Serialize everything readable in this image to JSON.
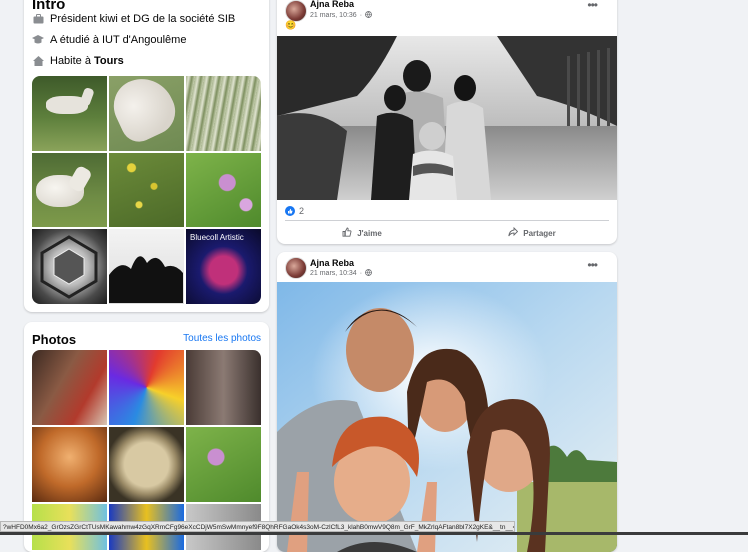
{
  "intro": {
    "title": "Intro",
    "work": "Président kiwi et DG de la société SIB",
    "education": "A étudié à IUT d'Angoulême",
    "lives_prefix": "Habite à ",
    "lives_city": "Tours",
    "tiles": [
      "",
      "",
      "",
      "",
      "",
      "",
      "",
      "",
      "Bluecoll Artistic"
    ]
  },
  "photos": {
    "title": "Photos",
    "all_link": "Toutes les photos"
  },
  "posts": [
    {
      "author": "Ajna Reba",
      "date": "21 mars, 10:36",
      "emoji": "😊",
      "reaction_count": "2",
      "like_label": "J'aime",
      "share_label": "Partager"
    },
    {
      "author": "Ajna Reba",
      "date": "21 mars, 10:34"
    }
  ],
  "status_url": "?wHFD0Mx6a2_GrOzsZGrCtTUsMKawahmw4zGqXRmCFg96eXcCDjW5mSwMmnyef9F8QhRFGaOk4s3oM-CzlCfL3_klahB0mwV9Q8m_GrF_MkZrlqAFtan8bI7X2gKE&__tn__=EH-R",
  "colors": {
    "accent": "#1877f2",
    "background": "#f0f2f5"
  }
}
